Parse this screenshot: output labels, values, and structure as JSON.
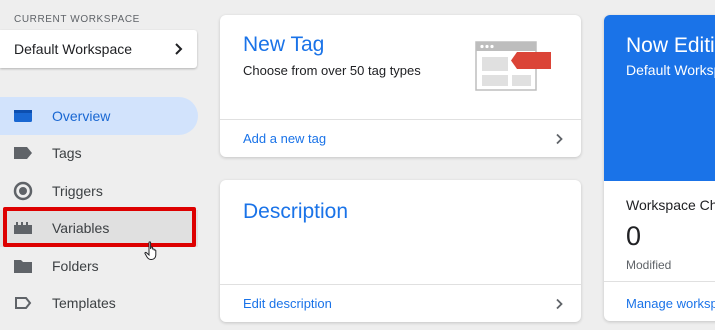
{
  "sidebar": {
    "workspace_label": "CURRENT WORKSPACE",
    "workspace_name": "Default Workspace",
    "items": [
      {
        "label": "Overview",
        "icon": "overview-icon",
        "active": true
      },
      {
        "label": "Tags",
        "icon": "tag-icon"
      },
      {
        "label": "Triggers",
        "icon": "trigger-icon"
      },
      {
        "label": "Variables",
        "icon": "variables-icon",
        "highlighted": true
      },
      {
        "label": "Folders",
        "icon": "folder-icon"
      },
      {
        "label": "Templates",
        "icon": "template-icon"
      }
    ]
  },
  "new_tag_card": {
    "title": "New Tag",
    "subtitle": "Choose from over 50 tag types",
    "link": "Add a new tag"
  },
  "description_card": {
    "title": "Description",
    "link": "Edit description"
  },
  "workspace_card": {
    "title": "Now Editing",
    "subtitle": "Default Workspace",
    "changes_label": "Workspace Changes",
    "count": "0",
    "modified_label": "Modified",
    "manage_link": "Manage workspaces"
  },
  "colors": {
    "accent": "#1a73e8",
    "active_bg": "#d2e3fc",
    "highlight": "#dd0000",
    "background": "#eeeeee"
  }
}
